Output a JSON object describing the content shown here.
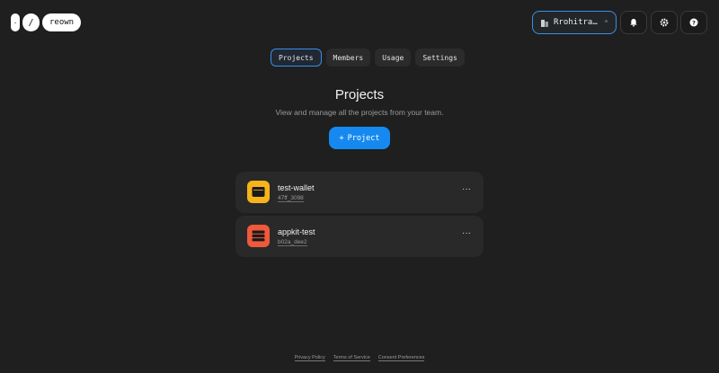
{
  "logo": {
    "mark1": "·",
    "mark2": "/",
    "brand": "reown"
  },
  "header": {
    "team_name": "Rrohitra…",
    "team_icon": "building-icon",
    "buttons": [
      "bell-icon",
      "gear-icon",
      "help-icon"
    ]
  },
  "tabs": [
    {
      "label": "Projects",
      "active": true
    },
    {
      "label": "Members"
    },
    {
      "label": "Usage"
    },
    {
      "label": "Settings"
    }
  ],
  "main": {
    "title": "Projects",
    "subtitle": "View and manage all the projects from your team.",
    "new_project_label": "Project",
    "new_project_plus": "+"
  },
  "projects": [
    {
      "name": "test-wallet",
      "id": "47ff_3098",
      "color": "#f6b41a",
      "icon": "wallet-icon"
    },
    {
      "name": "appkit-test",
      "id": "b02a_dee2",
      "color": "#f0593b",
      "icon": "layers-icon"
    }
  ],
  "more_label": "···",
  "footer": {
    "privacy": "Privacy Policy",
    "terms": "Terms of Service",
    "consent": "Consent Preferences"
  }
}
